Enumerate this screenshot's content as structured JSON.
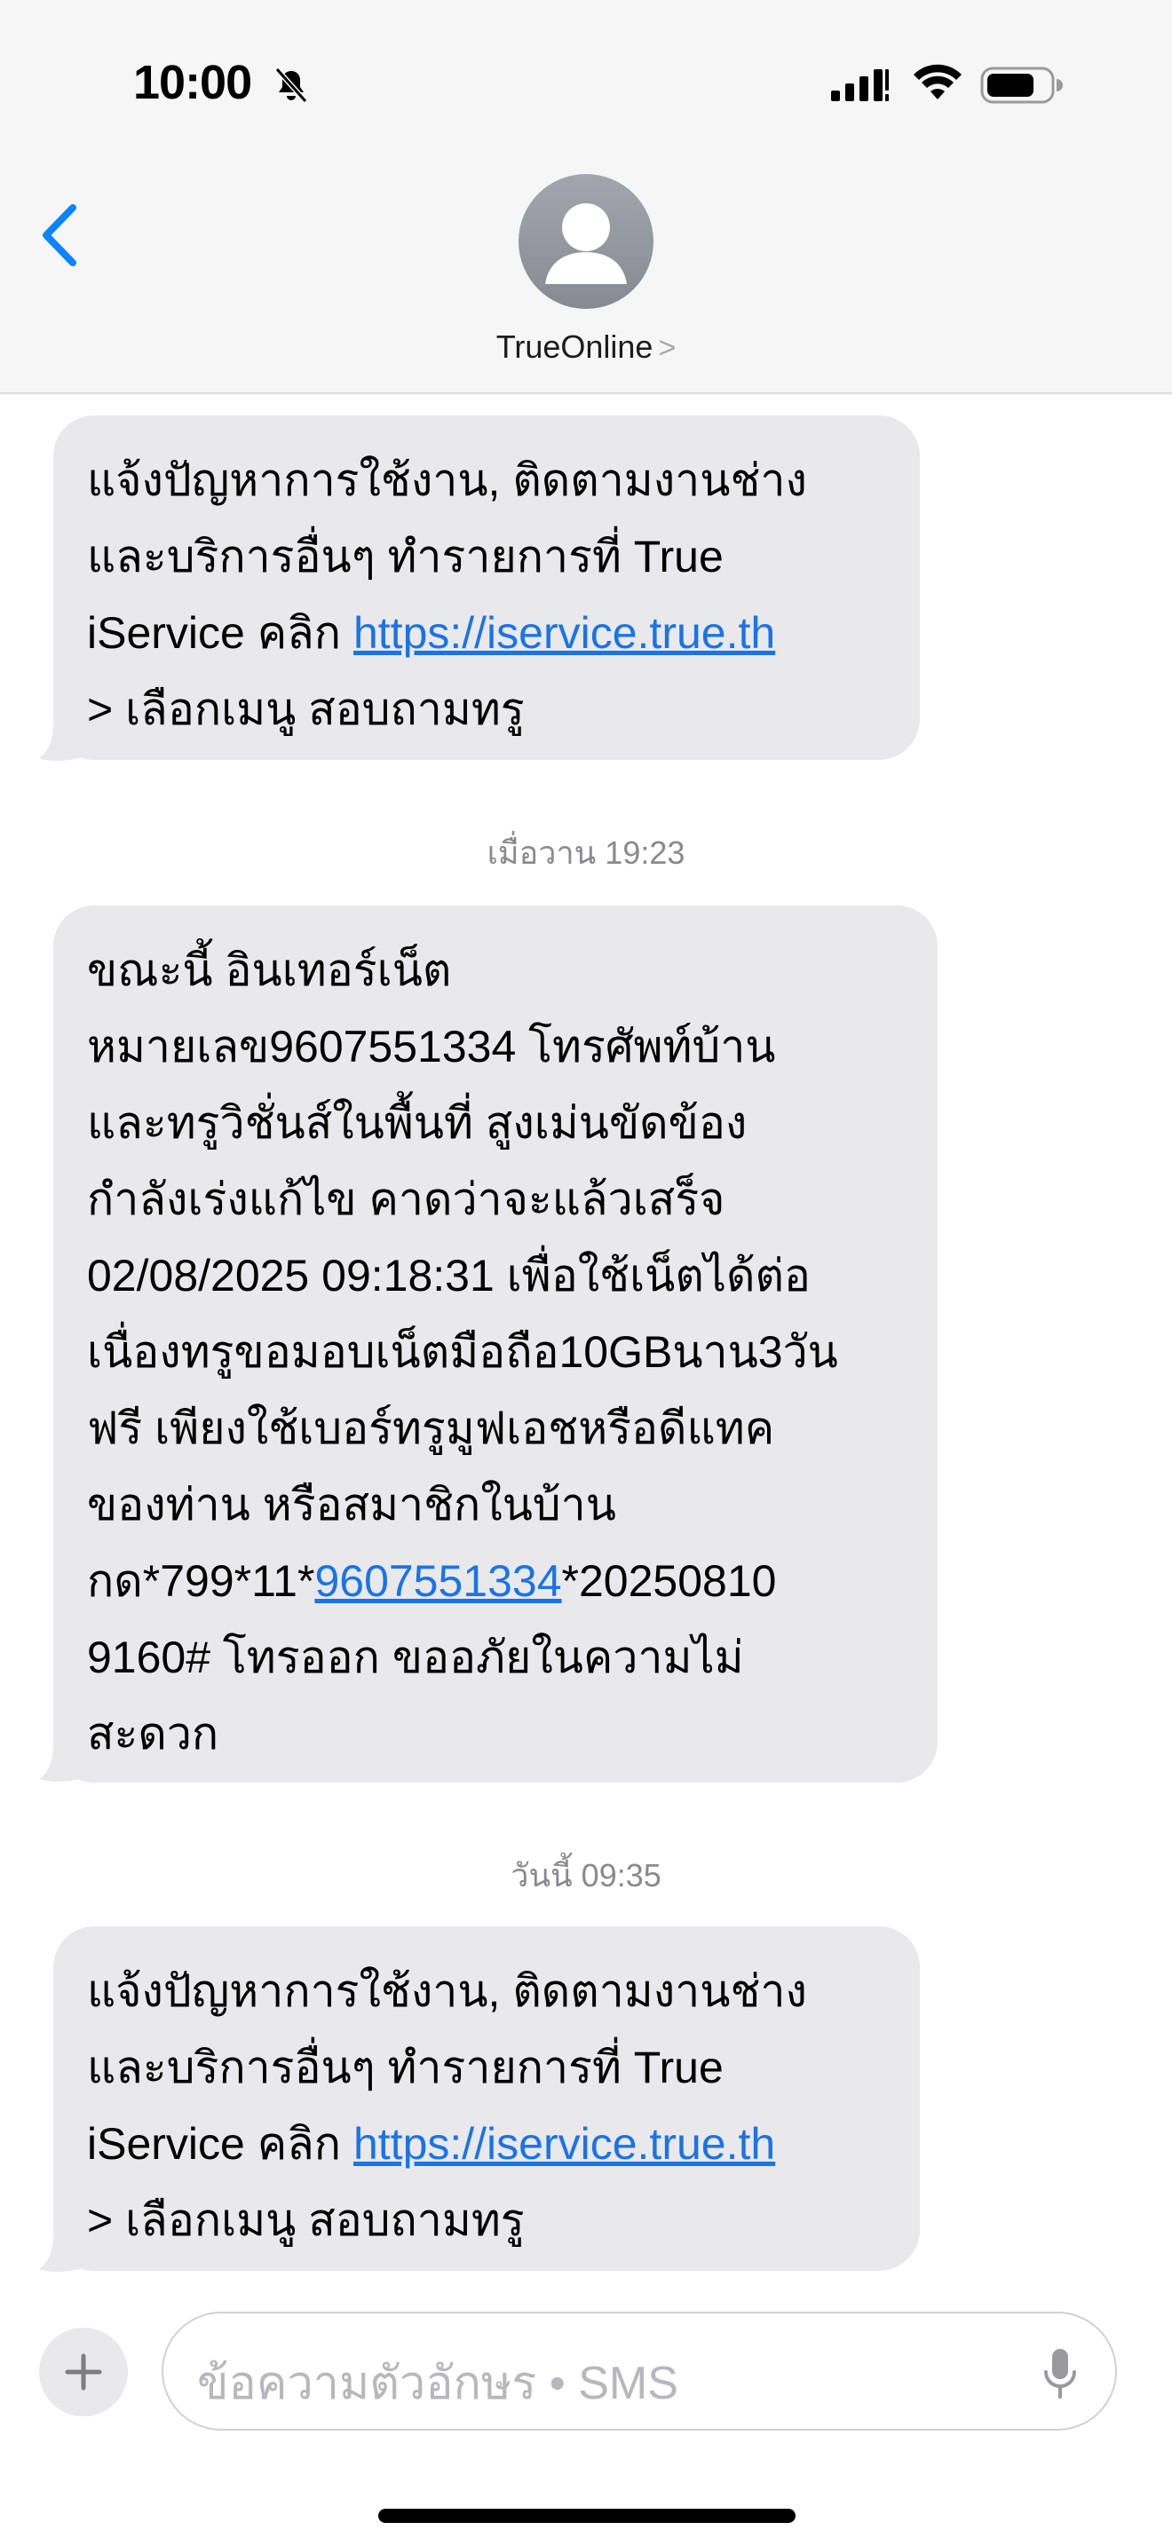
{
  "status_bar": {
    "time": "10:00"
  },
  "header": {
    "contact_name": "TrueOnline",
    "chevron": ">"
  },
  "messages": [
    {
      "lines": [
        "แจ้งปัญหาการใช้งาน, ติดตามงานช่าง",
        "และบริการอื่นๆ ทำรายการที่ True",
        "iService คลิก ",
        "> เลือกเมนู สอบถามทรู"
      ],
      "link": "https://iservice.true.th"
    },
    {
      "timestamp": "เมื่อวาน 19:23"
    },
    {
      "lines": [
        "ขณะนี้ อินเทอร์เน็ต",
        "หมายเลข9607551334 โทรศัพท์บ้าน",
        "และทรูวิชั่นส์ในพื้นที่ สูงเม่นขัดข้อง",
        "กำลังเร่งแก้ไข คาดว่าจะแล้วเสร็จ",
        "02/08/2025 09:18:31 เพื่อใช้เน็ตได้ต่อ",
        "เนื่องทรูขอมอบเน็ตมือถือ10GBนาน3วัน",
        "ฟรี เพียงใช้เบอร์ทรูมูฟเอชหรือดีแทค",
        "ของท่าน หรือสมาชิกในบ้าน",
        "กด*799*11*",
        "*20250810",
        "9160# โทรออก ขออภัยในความไม่",
        "สะดวก"
      ],
      "link": "9607551334"
    },
    {
      "timestamp": "วันนี้ 09:35"
    },
    {
      "lines": [
        "แจ้งปัญหาการใช้งาน, ติดตามงานช่าง",
        "และบริการอื่นๆ ทำรายการที่ True",
        "iService คลิก ",
        "> เลือกเมนู สอบถามทรู"
      ],
      "link": "https://iservice.true.th"
    }
  ],
  "composer": {
    "placeholder": "ข้อความตัวอักษร • SMS"
  },
  "colors": {
    "accent": "#1a73e8",
    "bubble": "#e9e9eb",
    "header_bg": "#f6f6f7",
    "back_arrow": "#0a84ff"
  },
  "icons": [
    "bell-slash-icon",
    "signal-icon",
    "wifi-icon",
    "battery-icon",
    "back-chevron-icon",
    "contact-avatar-icon",
    "plus-icon",
    "microphone-icon"
  ]
}
